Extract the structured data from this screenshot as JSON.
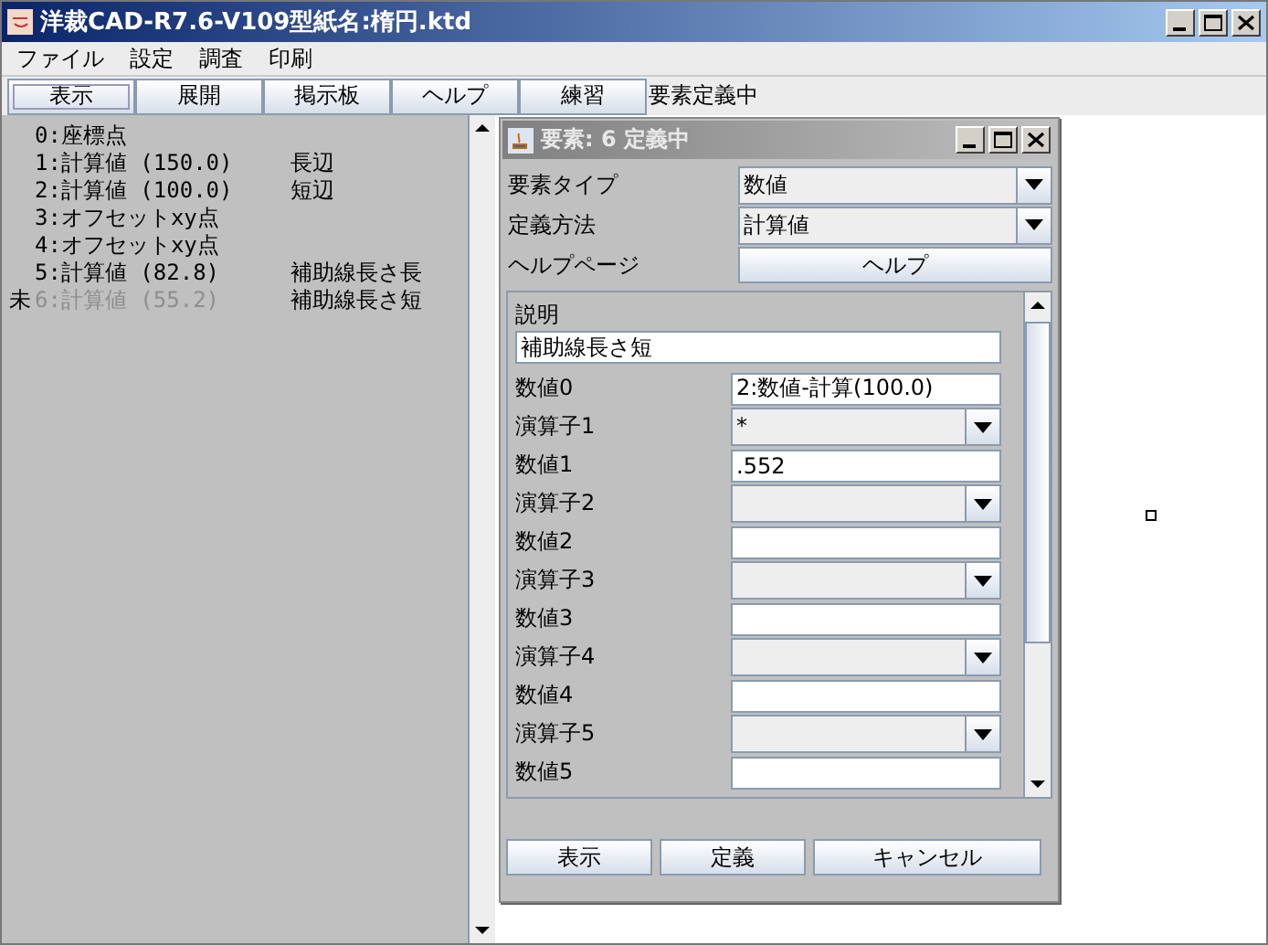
{
  "window": {
    "title": "洋裁CAD-R7.6-V109型紙名:楕円.ktd"
  },
  "menu": [
    "ファイル",
    "設定",
    "調査",
    "印刷"
  ],
  "toolbar": {
    "buttons": [
      {
        "label": "表示",
        "selected": true
      },
      {
        "label": "展開",
        "selected": false
      },
      {
        "label": "掲示板",
        "selected": false
      },
      {
        "label": "ヘルプ",
        "selected": false
      },
      {
        "label": "練習",
        "selected": false
      }
    ],
    "status": "要素定義中"
  },
  "elements": [
    {
      "label": "0:座標点",
      "pending": false
    },
    {
      "label": "1:計算値 (150.0)",
      "comment": "長辺",
      "pending": false
    },
    {
      "label": "2:計算値 (100.0)",
      "comment": "短辺",
      "pending": false
    },
    {
      "label": "3:オフセットxy点",
      "pending": false
    },
    {
      "label": "4:オフセットxy点",
      "pending": false
    },
    {
      "label": "5:計算値 (82.8)",
      "comment": "補助線長さ長",
      "pending": false
    },
    {
      "label": "6:計算値 (55.2)",
      "comment": "補助線長さ短",
      "pending": true,
      "marker": "未"
    }
  ],
  "dialog": {
    "title": "要素: 6 定義中",
    "header": [
      {
        "kind": "combo",
        "label": "要素タイプ",
        "value": "数値"
      },
      {
        "kind": "combo",
        "label": "定義方法",
        "value": "計算値"
      },
      {
        "kind": "button",
        "label": "ヘルプページ",
        "value": "ヘルプ"
      }
    ],
    "description": {
      "label": "説明",
      "value": "補助線長さ短"
    },
    "rows": [
      {
        "kind": "text",
        "label": "数値0",
        "value": "2:数値-計算(100.0)"
      },
      {
        "kind": "combo",
        "label": "演算子1",
        "value": "*"
      },
      {
        "kind": "text",
        "label": "数値1",
        "value": ".552"
      },
      {
        "kind": "combo",
        "label": "演算子2"
      },
      {
        "kind": "text",
        "label": "数値2"
      },
      {
        "kind": "combo",
        "label": "演算子3"
      },
      {
        "kind": "text",
        "label": "数値3"
      },
      {
        "kind": "combo",
        "label": "演算子4"
      },
      {
        "kind": "text",
        "label": "数値4"
      },
      {
        "kind": "combo",
        "label": "演算子5"
      },
      {
        "kind": "text",
        "label": "数値5"
      }
    ],
    "buttons": [
      "表示",
      "定義",
      "キャンセル"
    ]
  }
}
